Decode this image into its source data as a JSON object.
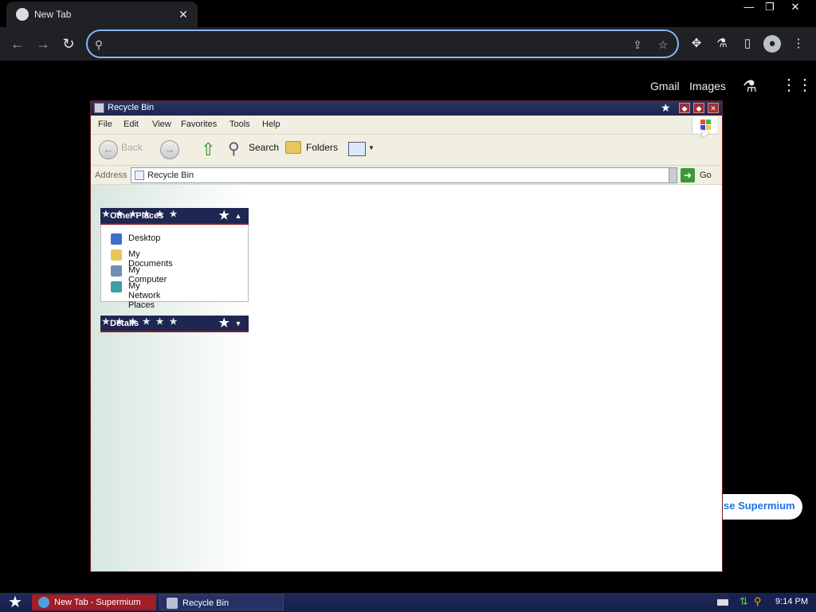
{
  "browser": {
    "tab_title": "New Tab",
    "tab_close_glyph": "✕",
    "window_controls": [
      "—",
      "❐",
      "✕"
    ],
    "omnibox_value": "",
    "top_links": [
      "Gmail",
      "Images"
    ]
  },
  "explorer": {
    "title": "Recycle Bin",
    "menu": [
      "File",
      "Edit",
      "View",
      "Favorites",
      "Tools",
      "Help"
    ],
    "toolbar": {
      "back": "Back",
      "search": "Search",
      "folders": "Folders"
    },
    "address_label": "Address",
    "address_value": "Recycle Bin",
    "go_label": "Go",
    "panes": {
      "other_places_title": "Other Places",
      "details_title": "Details",
      "places": [
        "Desktop",
        "My Documents",
        "My Computer",
        "My Network Places"
      ]
    }
  },
  "supermium_badge": "se Supermium",
  "taskbar": {
    "tasks": [
      "New Tab - Supermium",
      "Recycle Bin"
    ],
    "clock": "9:14 PM"
  },
  "colors": {
    "accent": "#8ab4f8",
    "xp_title": "#1e2651",
    "xp_red": "#8a1c22"
  }
}
